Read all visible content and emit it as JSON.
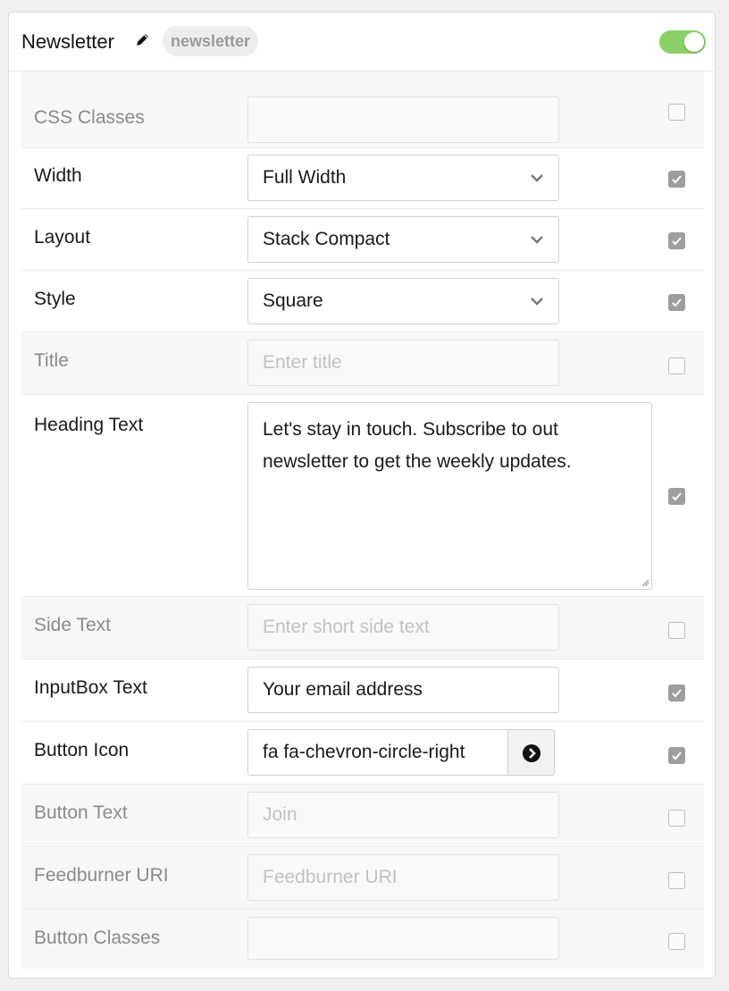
{
  "header": {
    "title": "Newsletter",
    "badge": "newsletter",
    "enabled": true
  },
  "colors": {
    "toggle_on": "#8cd067",
    "checkbox_checked": "#9e9e9e"
  },
  "fields": {
    "css_classes": {
      "label": "CSS Classes",
      "value": "",
      "placeholder": "",
      "checked": false
    },
    "width": {
      "label": "Width",
      "value": "Full Width",
      "checked": true
    },
    "layout": {
      "label": "Layout",
      "value": "Stack Compact",
      "checked": true
    },
    "style": {
      "label": "Style",
      "value": "Square",
      "checked": true
    },
    "title": {
      "label": "Title",
      "value": "",
      "placeholder": "Enter title",
      "checked": false
    },
    "heading_text": {
      "label": "Heading Text",
      "value": "Let's stay in touch. Subscribe to out newsletter to get the weekly updates.",
      "checked": true
    },
    "side_text": {
      "label": "Side Text",
      "value": "",
      "placeholder": "Enter short side text",
      "checked": false
    },
    "inputbox_text": {
      "label": "InputBox Text",
      "value": "Your email address",
      "checked": true
    },
    "button_icon": {
      "label": "Button Icon",
      "value": "fa fa-chevron-circle-right",
      "icon": "chevron-circle-right-icon",
      "checked": true
    },
    "button_text": {
      "label": "Button Text",
      "value": "",
      "placeholder": "Join",
      "checked": false
    },
    "feedburner_uri": {
      "label": "Feedburner URI",
      "value": "",
      "placeholder": "Feedburner URI",
      "checked": false
    },
    "button_classes": {
      "label": "Button Classes",
      "value": "",
      "placeholder": "",
      "checked": false
    }
  }
}
